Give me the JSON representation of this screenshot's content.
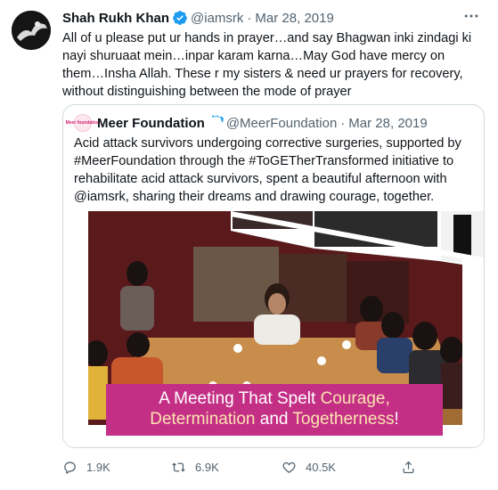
{
  "tweet": {
    "author_name": "Shah Rukh Khan",
    "handle": "@iamsrk",
    "separator": "·",
    "date": "Mar 28, 2019",
    "more_icon": "more-icon",
    "text": "All of u please put ur hands in prayer…and say Bhagwan inki zindagi ki nayi shuruaat mein…inpar karam karna…May God have mercy on them…Insha Allah. These r my sisters & need ur prayers for recovery, without distinguishing between the mode of prayer"
  },
  "quoted": {
    "author_name": "Meer Foundation",
    "avatar_text": "Meer foundation",
    "handle": "@MeerFoundation",
    "separator": "·",
    "date": "Mar 28, 2019",
    "text": "Acid attack survivors undergoing corrective surgeries, supported by #MeerFoundation through the #ToGETherTransformed initiative to rehabilitate acid attack survivors, spent a beautiful afternoon with @iamsrk, sharing their dreams and drawing courage, together.",
    "banner": {
      "line1_a": "A Meeting That Spelt ",
      "line1_b": "Courage,",
      "line2_a": "Determination ",
      "line2_b": "and ",
      "line2_c": "Togetherness",
      "line2_d": "!"
    }
  },
  "actions": {
    "replies": "1.9K",
    "retweets": "6.9K",
    "likes": "40.5K"
  },
  "colors": {
    "accent_blue": "#1d9bf0",
    "banner_magenta": "#c42f86",
    "muted_text": "#536471"
  }
}
